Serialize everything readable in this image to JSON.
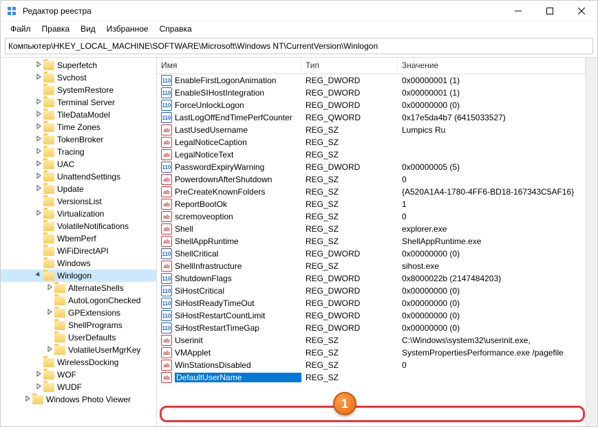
{
  "window": {
    "title": "Редактор реестра"
  },
  "menu": {
    "file": "Файл",
    "edit": "Правка",
    "view": "Вид",
    "favorites": "Избранное",
    "help": "Справка"
  },
  "address": "Компьютер\\HKEY_LOCAL_MACHINE\\SOFTWARE\\Microsoft\\Windows NT\\CurrentVersion\\Winlogon",
  "columns": {
    "name": "Имя",
    "type": "Тип",
    "value": "Значение"
  },
  "tree": [
    {
      "label": "Superfetch",
      "indent": 3,
      "expandable": true
    },
    {
      "label": "Svchost",
      "indent": 3,
      "expandable": true
    },
    {
      "label": "SystemRestore",
      "indent": 3,
      "expandable": false
    },
    {
      "label": "Terminal Server",
      "indent": 3,
      "expandable": true
    },
    {
      "label": "TileDataModel",
      "indent": 3,
      "expandable": true
    },
    {
      "label": "Time Zones",
      "indent": 3,
      "expandable": true
    },
    {
      "label": "TokenBroker",
      "indent": 3,
      "expandable": true
    },
    {
      "label": "Tracing",
      "indent": 3,
      "expandable": true
    },
    {
      "label": "UAC",
      "indent": 3,
      "expandable": true
    },
    {
      "label": "UnattendSettings",
      "indent": 3,
      "expandable": true
    },
    {
      "label": "Update",
      "indent": 3,
      "expandable": true
    },
    {
      "label": "VersionsList",
      "indent": 3,
      "expandable": false
    },
    {
      "label": "Virtualization",
      "indent": 3,
      "expandable": true
    },
    {
      "label": "VolatileNotifications",
      "indent": 3,
      "expandable": false
    },
    {
      "label": "WbemPerf",
      "indent": 3,
      "expandable": false
    },
    {
      "label": "WiFiDirectAPI",
      "indent": 3,
      "expandable": false
    },
    {
      "label": "Windows",
      "indent": 3,
      "expandable": false
    },
    {
      "label": "Winlogon",
      "indent": 3,
      "expandable": true,
      "expanded": true,
      "selected": true
    },
    {
      "label": "AlternateShells",
      "indent": 4,
      "expandable": true
    },
    {
      "label": "AutoLogonChecked",
      "indent": 4,
      "expandable": false
    },
    {
      "label": "GPExtensions",
      "indent": 4,
      "expandable": true
    },
    {
      "label": "ShellPrograms",
      "indent": 4,
      "expandable": false
    },
    {
      "label": "UserDefaults",
      "indent": 4,
      "expandable": false
    },
    {
      "label": "VolatileUserMgrKey",
      "indent": 4,
      "expandable": true
    },
    {
      "label": "WirelessDocking",
      "indent": 3,
      "expandable": false
    },
    {
      "label": "WOF",
      "indent": 3,
      "expandable": true
    },
    {
      "label": "WUDF",
      "indent": 3,
      "expandable": true
    },
    {
      "label": "Windows Photo Viewer",
      "indent": 2,
      "expandable": true
    }
  ],
  "values": [
    {
      "name": "EnableFirstLogonAnimation",
      "type": "REG_DWORD",
      "value": "0x00000001 (1)",
      "icon": "bin"
    },
    {
      "name": "EnableSIHostIntegration",
      "type": "REG_DWORD",
      "value": "0x00000001 (1)",
      "icon": "bin"
    },
    {
      "name": "ForceUnlockLogon",
      "type": "REG_DWORD",
      "value": "0x00000000 (0)",
      "icon": "bin"
    },
    {
      "name": "LastLogOffEndTimePerfCounter",
      "type": "REG_QWORD",
      "value": "0x17e5da4b7 (6415033527)",
      "icon": "bin"
    },
    {
      "name": "LastUsedUsername",
      "type": "REG_SZ",
      "value": "Lumpics Ru",
      "icon": "str"
    },
    {
      "name": "LegalNoticeCaption",
      "type": "REG_SZ",
      "value": "",
      "icon": "str"
    },
    {
      "name": "LegalNoticeText",
      "type": "REG_SZ",
      "value": "",
      "icon": "str"
    },
    {
      "name": "PasswordExpiryWarning",
      "type": "REG_DWORD",
      "value": "0x00000005 (5)",
      "icon": "bin"
    },
    {
      "name": "PowerdownAfterShutdown",
      "type": "REG_SZ",
      "value": "0",
      "icon": "str"
    },
    {
      "name": "PreCreateKnownFolders",
      "type": "REG_SZ",
      "value": "{A520A1A4-1780-4FF6-BD18-167343C5AF16}",
      "icon": "str"
    },
    {
      "name": "ReportBootOk",
      "type": "REG_SZ",
      "value": "1",
      "icon": "str"
    },
    {
      "name": "scremoveoption",
      "type": "REG_SZ",
      "value": "0",
      "icon": "str"
    },
    {
      "name": "Shell",
      "type": "REG_SZ",
      "value": "explorer.exe",
      "icon": "str"
    },
    {
      "name": "ShellAppRuntime",
      "type": "REG_SZ",
      "value": "ShellAppRuntime.exe",
      "icon": "str"
    },
    {
      "name": "ShellCritical",
      "type": "REG_DWORD",
      "value": "0x00000000 (0)",
      "icon": "bin"
    },
    {
      "name": "ShellInfrastructure",
      "type": "REG_SZ",
      "value": "sihost.exe",
      "icon": "str"
    },
    {
      "name": "ShutdownFlags",
      "type": "REG_DWORD",
      "value": "0x8000022b (2147484203)",
      "icon": "bin"
    },
    {
      "name": "SiHostCritical",
      "type": "REG_DWORD",
      "value": "0x00000000 (0)",
      "icon": "bin"
    },
    {
      "name": "SiHostReadyTimeOut",
      "type": "REG_DWORD",
      "value": "0x00000000 (0)",
      "icon": "bin"
    },
    {
      "name": "SiHostRestartCountLimit",
      "type": "REG_DWORD",
      "value": "0x00000000 (0)",
      "icon": "bin"
    },
    {
      "name": "SiHostRestartTimeGap",
      "type": "REG_DWORD",
      "value": "0x00000000 (0)",
      "icon": "bin"
    },
    {
      "name": "Userinit",
      "type": "REG_SZ",
      "value": "C:\\Windows\\system32\\userinit.exe,",
      "icon": "str"
    },
    {
      "name": "VMApplet",
      "type": "REG_SZ",
      "value": "SystemPropertiesPerformance.exe /pagefile",
      "icon": "str"
    },
    {
      "name": "WinStationsDisabled",
      "type": "REG_SZ",
      "value": "0",
      "icon": "str"
    },
    {
      "name": "DefaultUserName",
      "type": "REG_SZ",
      "value": "",
      "icon": "str",
      "editing": true
    }
  ],
  "callout": "1"
}
